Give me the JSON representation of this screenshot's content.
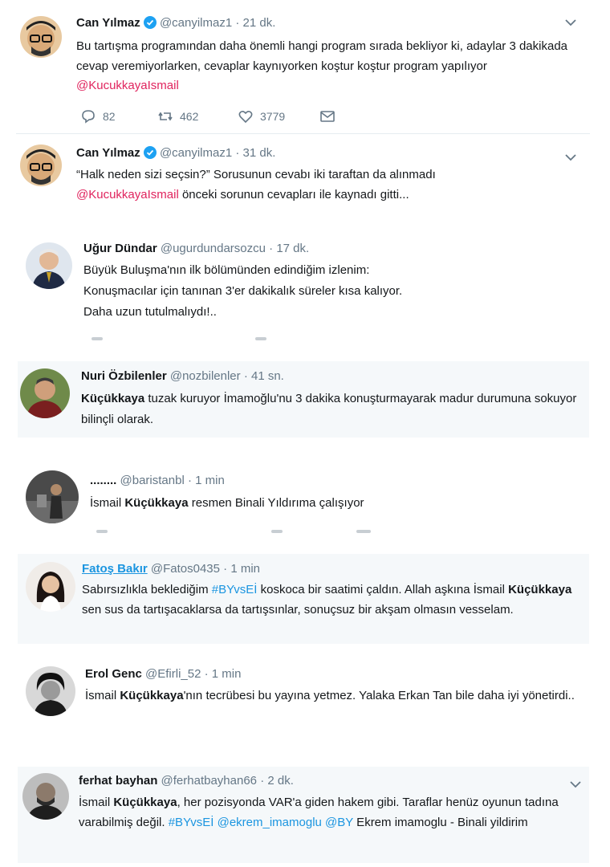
{
  "tweets": [
    {
      "name": "Can Yılmaz",
      "handle": "@canyilmaz1",
      "time": "· 21 dk.",
      "text": "Bu tartışma programından daha önemli hangi program sırada bekliyor ki, adaylar 3 dakikada cevap veremiyorlarken, cevaplar kaynıyorken koştur koştur program yapılıyor ",
      "mention": "@KucukkayaIsmail",
      "replies": "82",
      "retweets": "462",
      "likes": "3779"
    },
    {
      "name": "Can Yılmaz",
      "handle": "@canyilmaz1",
      "time": "· 31 dk.",
      "text_line1": "“Halk neden sizi seçsin?” Sorusunun cevabı iki taraftan da alınmadı",
      "mention": "@KucukkayaIsmail",
      "text_after": "  önceki sorunun cevapları ile kaynadı gitti..."
    },
    {
      "name": "Uğur Dündar",
      "handle": "@ugurdundarsozcu",
      "time": "· 17 dk.",
      "line1": "Büyük Buluşma'nın ilk bölümünden edindiğim izlenim:",
      "line2": "Konuşmacılar için tanınan 3'er dakikalık süreler kısa kalıyor.",
      "line3": "Daha uzun tutulmalıydı!.."
    },
    {
      "name": "Nuri Özbilenler",
      "handle": "@nozbilenler",
      "time": "· 41 sn.",
      "bold": "Küçükkaya",
      "text": " tuzak kuruyor İmamoğlu'nu 3 dakika konuşturmayarak madur durumuna sokuyor bilinçli olarak."
    },
    {
      "name": "........",
      "handle": "@baristanbl",
      "time": "· 1 min",
      "pre": "İsmail ",
      "bold": "Küçükkaya",
      "post": " resmen Binali Yıldırıma çalışıyor"
    },
    {
      "name": "Fatoş Bakır",
      "handle": "@Fatos0435",
      "time": "· 1 min",
      "pre": "Sabırsızlıkla beklediğim ",
      "hashtag": "#BYvsEİ",
      "mid": " koskoca bir saatimi çaldın. Allah aşkına İsmail ",
      "bold": "Küçükkaya",
      "post": " sen sus da tartışacaklarsa da tartışsınlar, sonuçsuz bir akşam olmasın vesselam."
    },
    {
      "name": "Erol Genc",
      "handle": "@Efirli_52",
      "time": "· 1 min",
      "pre": "İsmail ",
      "bold": "Küçükkaya",
      "post": "'nın tecrübesi bu yayına yetmez. Yalaka Erkan Tan bile daha iyi yönetirdi.."
    },
    {
      "name": "ferhat bayhan",
      "handle": "@ferhatbayhan66",
      "time": "· 2 dk.",
      "pre": "İsmail ",
      "bold": "Küçükkaya",
      "mid": ", her pozisyonda VAR'a giden hakem gibi. Taraflar henüz oyunun tadına varabilmiş değil. ",
      "hashtag": "#BYvsEİ",
      "mention1": "@ekrem_imamoglu",
      "mention2": "@BY",
      "post": " Ekrem imamoglu - Binali yildirim"
    }
  ],
  "colors": {
    "mention": "#e0245e",
    "hashtag": "#1b95e0",
    "muted": "#657786",
    "verified": "#1da1f2"
  },
  "icons": [
    "reply-icon",
    "retweet-icon",
    "like-icon",
    "dm-icon",
    "chevron-down-icon",
    "verified-icon"
  ]
}
